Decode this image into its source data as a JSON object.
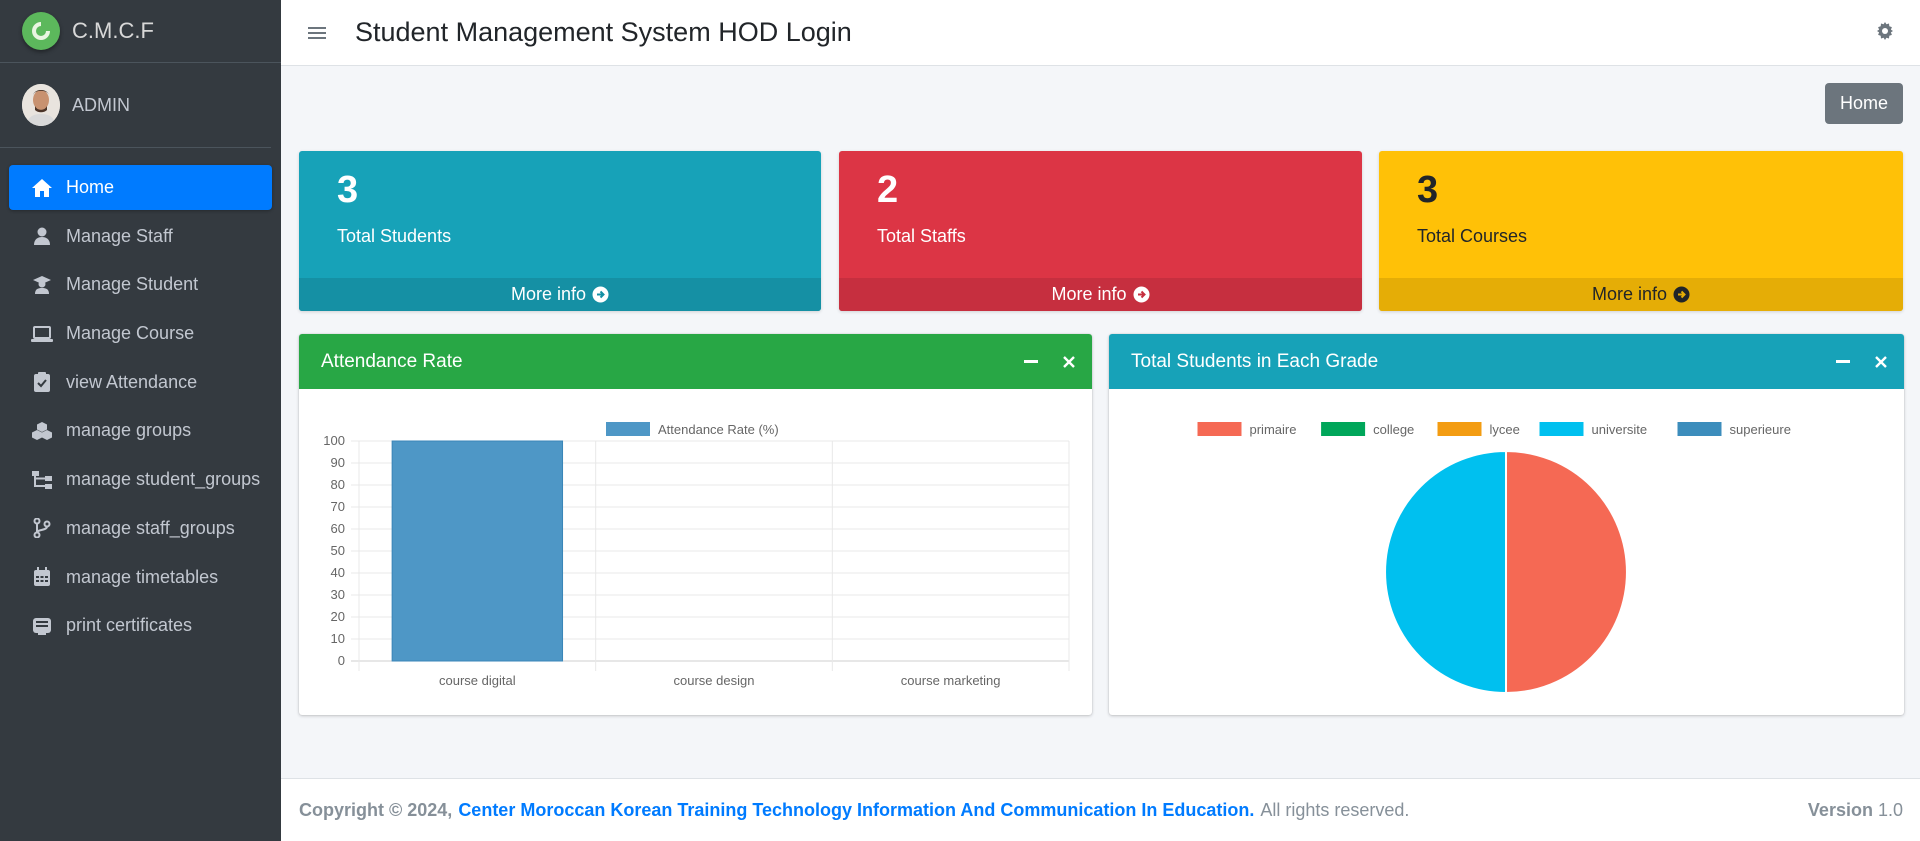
{
  "brand": {
    "name": "C.M.C.F"
  },
  "user": {
    "name": "ADMIN"
  },
  "sidebar": {
    "items": [
      {
        "label": "Home",
        "icon": "home-icon",
        "active": true
      },
      {
        "label": "Manage Staff",
        "icon": "user-icon"
      },
      {
        "label": "Manage Student",
        "icon": "graduate-icon"
      },
      {
        "label": "Manage Course",
        "icon": "laptop-icon"
      },
      {
        "label": "view Attendance",
        "icon": "clipboard-check-icon"
      },
      {
        "label": "manage groups",
        "icon": "cubes-icon"
      },
      {
        "label": "manage student_groups",
        "icon": "sitemap-icon"
      },
      {
        "label": "manage staff_groups",
        "icon": "code-branch-icon"
      },
      {
        "label": "manage timetables",
        "icon": "calendar-icon"
      },
      {
        "label": "print certificates",
        "icon": "certificate-icon"
      }
    ]
  },
  "header": {
    "title": "Student Management System HOD Login"
  },
  "breadcrumb": {
    "home": "Home"
  },
  "stats": [
    {
      "value": "3",
      "label": "Total Students",
      "more": "More info",
      "color": "#17a2b8"
    },
    {
      "value": "2",
      "label": "Total Staffs",
      "more": "More info",
      "color": "#dc3545"
    },
    {
      "value": "3",
      "label": "Total Courses",
      "more": "More info",
      "color": "#ffc107"
    }
  ],
  "cards": {
    "attendance": {
      "title": "Attendance Rate"
    },
    "grades": {
      "title": "Total Students in Each Grade"
    }
  },
  "chart_data": [
    {
      "type": "bar",
      "legend": [
        "Attendance Rate (%)"
      ],
      "categories": [
        "course digital",
        "course design",
        "course marketing"
      ],
      "series": [
        {
          "name": "Attendance Rate (%)",
          "values": [
            100,
            0,
            0
          ],
          "color": "#4e97c6"
        }
      ],
      "ylim": [
        0,
        100
      ],
      "yticks": [
        0,
        10,
        20,
        30,
        40,
        50,
        60,
        70,
        80,
        90,
        100
      ],
      "grid": true,
      "legend_position": "top"
    },
    {
      "type": "pie",
      "labels": [
        "primaire",
        "college",
        "lycee",
        "universite",
        "superieure"
      ],
      "values": [
        1,
        0,
        0,
        1,
        0
      ],
      "colors": [
        "#f56954",
        "#00a65a",
        "#f39c12",
        "#00c0ef",
        "#3c8dbc"
      ],
      "legend_position": "top"
    }
  ],
  "footer": {
    "copyright": "Copyright © 2024,",
    "org": "Center Moroccan Korean Training Technology Information And Communication In Education.",
    "rights": "All rights reserved.",
    "version_label": "Version",
    "version": "1.0"
  }
}
